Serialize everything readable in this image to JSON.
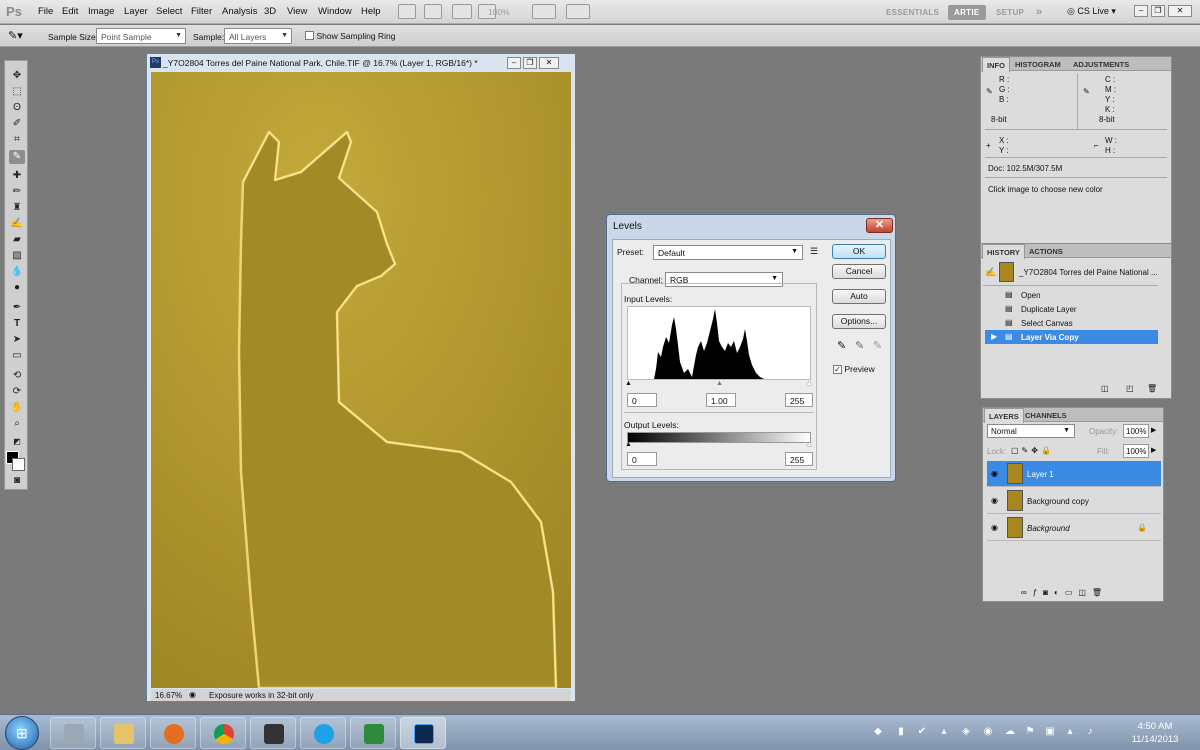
{
  "menubar": {
    "logo": "Ps",
    "items": [
      "File",
      "Edit",
      "Image",
      "Layer",
      "Select",
      "Filter",
      "Analysis",
      "3D",
      "View",
      "Window",
      "Help"
    ],
    "zoom": "100%",
    "workspaces": [
      "ESSENTIALS",
      "ARTIE",
      "SETUP"
    ],
    "active_workspace": "ARTIE",
    "more": "»",
    "cs_live": "CS Live"
  },
  "options": {
    "sample_size_label": "Sample Size:",
    "sample_size_value": "Point Sample",
    "sample_label": "Sample:",
    "sample_value": "All Layers",
    "sampling_ring_label": "Show Sampling Ring"
  },
  "document": {
    "title": "_Y7O2804  Torres del Paine National Park, Chile.TIF @ 16.7% (Layer 1, RGB/16*) *",
    "zoom": "16.67%",
    "status": "Exposure works in 32-bit only"
  },
  "levels": {
    "title": "Levels",
    "preset_label": "Preset:",
    "preset_value": "Default",
    "channel_label": "Channel:",
    "channel_value": "RGB",
    "input_label": "Input Levels:",
    "input_black": "0",
    "input_gamma": "1.00",
    "input_white": "255",
    "output_label": "Output Levels:",
    "output_black": "0",
    "output_white": "255",
    "buttons": {
      "ok": "OK",
      "cancel": "Cancel",
      "auto": "Auto",
      "options": "Options..."
    },
    "preview_label": "Preview",
    "preview_checked": true
  },
  "info_panel": {
    "tabs": [
      "INFO",
      "HISTOGRAM",
      "ADJUSTMENTS"
    ],
    "rgb": [
      "R :",
      "G :",
      "B :"
    ],
    "cmyk": [
      "C :",
      "M :",
      "Y :",
      "K :"
    ],
    "bitdepth_left": "8-bit",
    "bitdepth_right": "8-bit",
    "xy": [
      "X :",
      "Y :"
    ],
    "wh": [
      "W :",
      "H :"
    ],
    "doc": "Doc: 102.5M/307.5M",
    "hint": "Click image to choose new color"
  },
  "history_panel": {
    "tabs": [
      "HISTORY",
      "ACTIONS"
    ],
    "snapshot": "_Y7O2804  Torres del Paine National ...",
    "items": [
      "Open",
      "Duplicate Layer",
      "Select Canvas",
      "Layer Via Copy"
    ],
    "selected_index": 3
  },
  "layers_panel": {
    "tabs": [
      "LAYERS",
      "CHANNELS"
    ],
    "blend_mode": "Normal",
    "opacity_label": "Opacity:",
    "opacity_value": "100%",
    "lock_label": "Lock:",
    "fill_label": "Fill:",
    "fill_value": "100%",
    "layers": [
      "Layer 1",
      "Background copy",
      "Background"
    ],
    "selected_index": 0
  },
  "taskbar": {
    "time": "4:50 AM",
    "date": "11/14/2013",
    "apps": [
      "start",
      "calculator",
      "explorer",
      "firefox",
      "chrome",
      "camera",
      "skype",
      "excel",
      "photoshop"
    ]
  },
  "colors": {
    "canvas": "#b29a2e",
    "selection": "#3b8ae4",
    "taskbar": "#8fa3bd"
  }
}
